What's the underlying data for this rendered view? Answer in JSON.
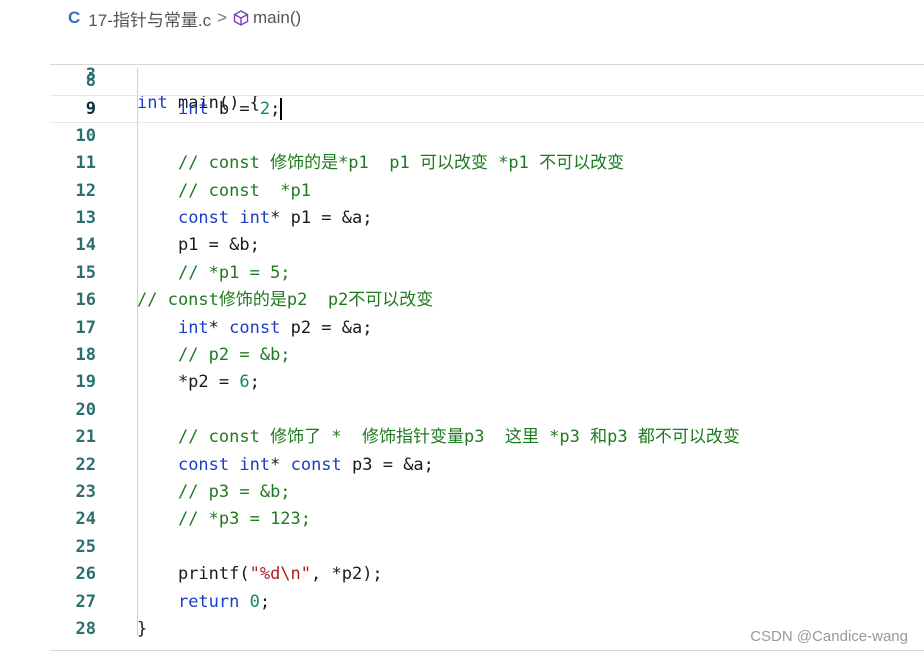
{
  "breadcrumb": {
    "file_icon": "C",
    "file_name": "17-指针与常量.c",
    "separator": ">",
    "symbol_icon": "cube-icon",
    "symbol_name": "main()"
  },
  "sticky": {
    "line_no": "3",
    "text": "int main() {"
  },
  "lines": [
    {
      "no": "8",
      "text": ""
    },
    {
      "no": "9",
      "text": "    int b = 2;"
    },
    {
      "no": "10",
      "text": ""
    },
    {
      "no": "11",
      "text": "    // const 修饰的是*p1  p1 可以改变 *p1 不可以改变"
    },
    {
      "no": "12",
      "text": "    // const  *p1"
    },
    {
      "no": "13",
      "text": "    const int* p1 = &a;"
    },
    {
      "no": "14",
      "text": "    p1 = &b;"
    },
    {
      "no": "15",
      "text": "    // *p1 = 5;"
    },
    {
      "no": "16",
      "text": "// const修饰的是p2  p2不可以改变"
    },
    {
      "no": "17",
      "text": "    int* const p2 = &a;"
    },
    {
      "no": "18",
      "text": "    // p2 = &b;"
    },
    {
      "no": "19",
      "text": "    *p2 = 6;"
    },
    {
      "no": "20",
      "text": ""
    },
    {
      "no": "21",
      "text": "    // const 修饰了 *  修饰指针变量p3  这里 *p3 和p3 都不可以改变"
    },
    {
      "no": "22",
      "text": "    const int* const p3 = &a;"
    },
    {
      "no": "23",
      "text": "    // p3 = &b;"
    },
    {
      "no": "24",
      "text": "    // *p3 = 123;"
    },
    {
      "no": "25",
      "text": ""
    },
    {
      "no": "26",
      "text": "    printf(\"%d\\n\", *p2);"
    },
    {
      "no": "27",
      "text": "    return 0;"
    },
    {
      "no": "28",
      "text": "}"
    }
  ],
  "active_line": "9",
  "watermark": "CSDN @Candice-wang",
  "colors": {
    "keyword": "#1a3dc8",
    "number": "#0a8a6a",
    "string": "#b02020",
    "comment": "#1f7a1f",
    "line_number": "#2a7070"
  }
}
